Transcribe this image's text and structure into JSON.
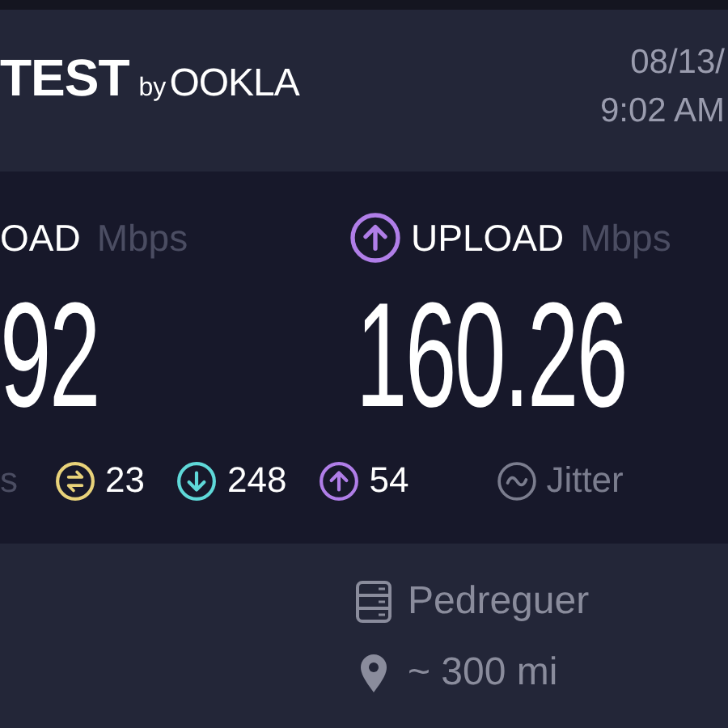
{
  "header": {
    "logo_text": "TEST",
    "logo_by": "by",
    "logo_brand": "OOKLA",
    "date": "08/13/",
    "time": "9:02 AM"
  },
  "results": [
    {
      "kind": "download",
      "label": "OAD",
      "unit": "Mbps",
      "value": "92"
    },
    {
      "kind": "upload",
      "label": "UPLOAD",
      "unit": "Mbps",
      "value": "160.26"
    }
  ],
  "ping": {
    "unit": "s",
    "stats": [
      {
        "kind": "idle",
        "value": "23"
      },
      {
        "kind": "download",
        "value": "248"
      },
      {
        "kind": "upload",
        "value": "54"
      }
    ]
  },
  "jitter": {
    "label": "Jitter"
  },
  "server": {
    "name": "Pedreguer",
    "distance": "~ 300 mi"
  }
}
